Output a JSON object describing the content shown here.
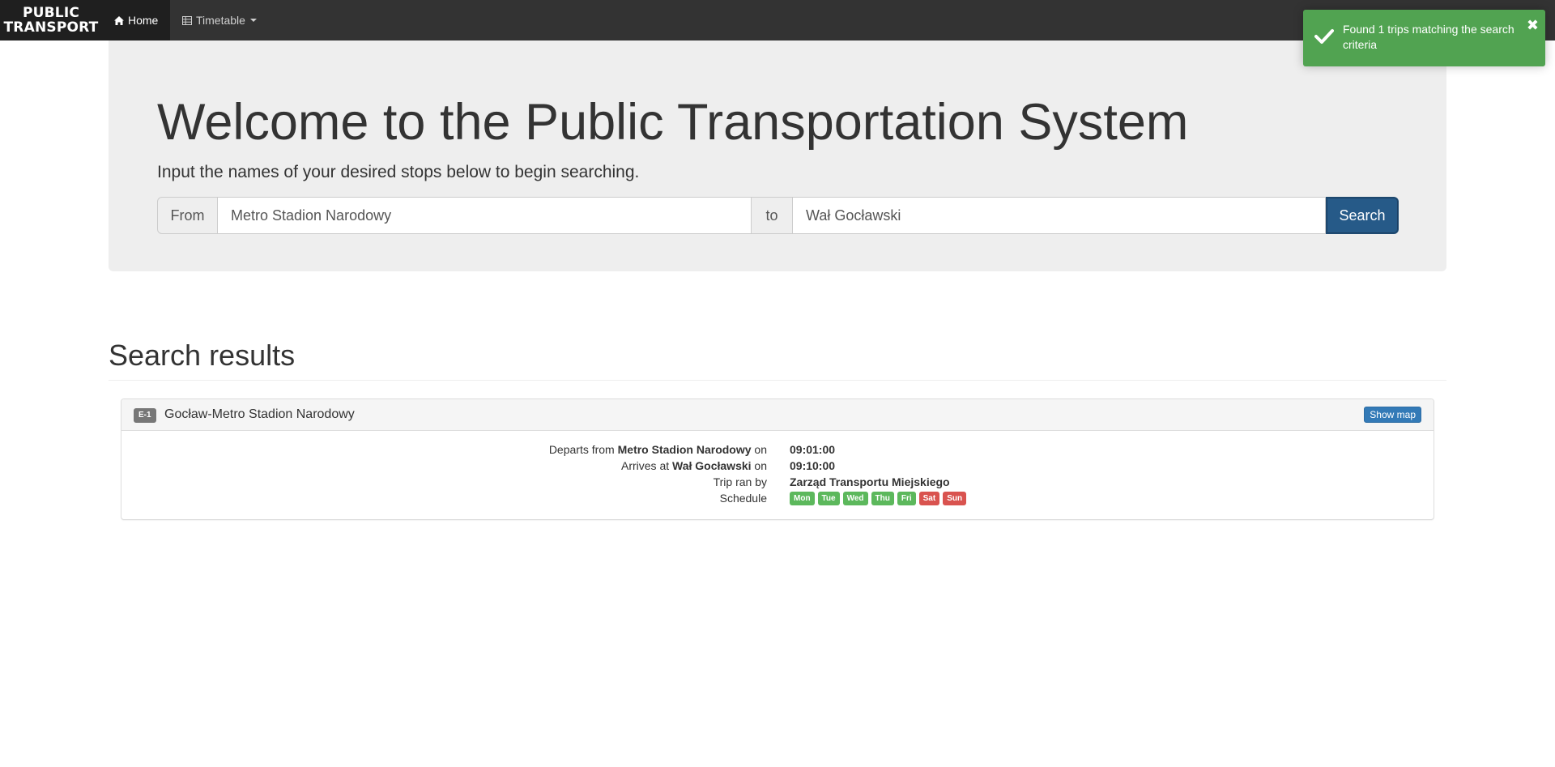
{
  "navbar": {
    "brand_line1": "PUBLIC",
    "brand_line2": "TRANSPORT",
    "home_label": "Home",
    "timetable_label": "Timetable"
  },
  "hero": {
    "title": "Welcome to the Public Transportation System",
    "lead": "Input the names of your desired stops below to begin searching.",
    "from_label": "From",
    "from_value": "Metro Stadion Narodowy",
    "to_label": "to",
    "to_value": "Wał Gocławski",
    "search_label": "Search"
  },
  "results": {
    "title": "Search results",
    "trips": [
      {
        "route": "E-1",
        "name": "Gocław-Metro Stadion Narodowy",
        "show_map_label": "Show map",
        "departs_prefix": "Departs from",
        "departs_stop": "Metro Stadion Narodowy",
        "departs_suffix": "on",
        "departs_time": "09:01:00",
        "arrives_prefix": "Arrives at",
        "arrives_stop": "Wał Gocławski",
        "arrives_suffix": "on",
        "arrives_time": "09:10:00",
        "operator_label": "Trip ran by",
        "operator": "Zarząd Transportu Miejskiego",
        "schedule_label": "Schedule",
        "days": [
          {
            "label": "Mon",
            "active": true
          },
          {
            "label": "Tue",
            "active": true
          },
          {
            "label": "Wed",
            "active": true
          },
          {
            "label": "Thu",
            "active": true
          },
          {
            "label": "Fri",
            "active": true
          },
          {
            "label": "Sat",
            "active": false
          },
          {
            "label": "Sun",
            "active": false
          }
        ]
      }
    ]
  },
  "toast": {
    "message": "Found 1 trips matching the search criteria",
    "close_glyph": "✖"
  },
  "colors": {
    "navbar": "#333333",
    "primary_button": "#265a88",
    "toast_success": "#51a351",
    "day_on": "#5cb85c",
    "day_off": "#d9534f"
  },
  "icons": {
    "home": "home-icon",
    "timetable": "table-icon",
    "toast": "checkmark-icon",
    "close": "close-icon"
  }
}
